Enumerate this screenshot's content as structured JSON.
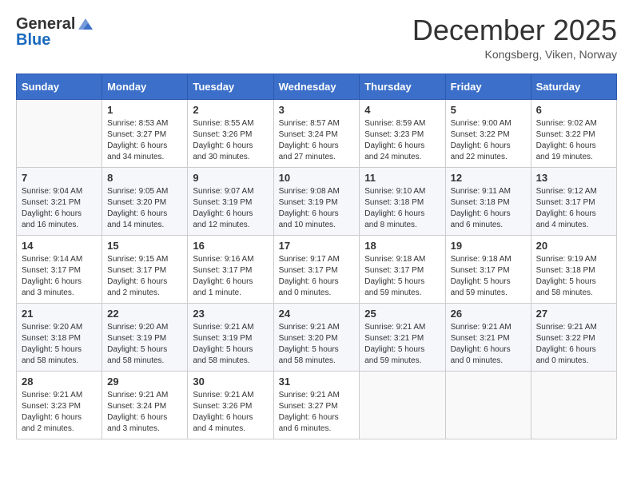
{
  "header": {
    "logo_general": "General",
    "logo_blue": "Blue",
    "month_title": "December 2025",
    "location": "Kongsberg, Viken, Norway"
  },
  "days_of_week": [
    "Sunday",
    "Monday",
    "Tuesday",
    "Wednesday",
    "Thursday",
    "Friday",
    "Saturday"
  ],
  "weeks": [
    [
      {
        "day": "",
        "info": ""
      },
      {
        "day": "1",
        "info": "Sunrise: 8:53 AM\nSunset: 3:27 PM\nDaylight: 6 hours\nand 34 minutes."
      },
      {
        "day": "2",
        "info": "Sunrise: 8:55 AM\nSunset: 3:26 PM\nDaylight: 6 hours\nand 30 minutes."
      },
      {
        "day": "3",
        "info": "Sunrise: 8:57 AM\nSunset: 3:24 PM\nDaylight: 6 hours\nand 27 minutes."
      },
      {
        "day": "4",
        "info": "Sunrise: 8:59 AM\nSunset: 3:23 PM\nDaylight: 6 hours\nand 24 minutes."
      },
      {
        "day": "5",
        "info": "Sunrise: 9:00 AM\nSunset: 3:22 PM\nDaylight: 6 hours\nand 22 minutes."
      },
      {
        "day": "6",
        "info": "Sunrise: 9:02 AM\nSunset: 3:22 PM\nDaylight: 6 hours\nand 19 minutes."
      }
    ],
    [
      {
        "day": "7",
        "info": "Sunrise: 9:04 AM\nSunset: 3:21 PM\nDaylight: 6 hours\nand 16 minutes."
      },
      {
        "day": "8",
        "info": "Sunrise: 9:05 AM\nSunset: 3:20 PM\nDaylight: 6 hours\nand 14 minutes."
      },
      {
        "day": "9",
        "info": "Sunrise: 9:07 AM\nSunset: 3:19 PM\nDaylight: 6 hours\nand 12 minutes."
      },
      {
        "day": "10",
        "info": "Sunrise: 9:08 AM\nSunset: 3:19 PM\nDaylight: 6 hours\nand 10 minutes."
      },
      {
        "day": "11",
        "info": "Sunrise: 9:10 AM\nSunset: 3:18 PM\nDaylight: 6 hours\nand 8 minutes."
      },
      {
        "day": "12",
        "info": "Sunrise: 9:11 AM\nSunset: 3:18 PM\nDaylight: 6 hours\nand 6 minutes."
      },
      {
        "day": "13",
        "info": "Sunrise: 9:12 AM\nSunset: 3:17 PM\nDaylight: 6 hours\nand 4 minutes."
      }
    ],
    [
      {
        "day": "14",
        "info": "Sunrise: 9:14 AM\nSunset: 3:17 PM\nDaylight: 6 hours\nand 3 minutes."
      },
      {
        "day": "15",
        "info": "Sunrise: 9:15 AM\nSunset: 3:17 PM\nDaylight: 6 hours\nand 2 minutes."
      },
      {
        "day": "16",
        "info": "Sunrise: 9:16 AM\nSunset: 3:17 PM\nDaylight: 6 hours\nand 1 minute."
      },
      {
        "day": "17",
        "info": "Sunrise: 9:17 AM\nSunset: 3:17 PM\nDaylight: 6 hours\nand 0 minutes."
      },
      {
        "day": "18",
        "info": "Sunrise: 9:18 AM\nSunset: 3:17 PM\nDaylight: 5 hours\nand 59 minutes."
      },
      {
        "day": "19",
        "info": "Sunrise: 9:18 AM\nSunset: 3:17 PM\nDaylight: 5 hours\nand 59 minutes."
      },
      {
        "day": "20",
        "info": "Sunrise: 9:19 AM\nSunset: 3:18 PM\nDaylight: 5 hours\nand 58 minutes."
      }
    ],
    [
      {
        "day": "21",
        "info": "Sunrise: 9:20 AM\nSunset: 3:18 PM\nDaylight: 5 hours\nand 58 minutes."
      },
      {
        "day": "22",
        "info": "Sunrise: 9:20 AM\nSunset: 3:19 PM\nDaylight: 5 hours\nand 58 minutes."
      },
      {
        "day": "23",
        "info": "Sunrise: 9:21 AM\nSunset: 3:19 PM\nDaylight: 5 hours\nand 58 minutes."
      },
      {
        "day": "24",
        "info": "Sunrise: 9:21 AM\nSunset: 3:20 PM\nDaylight: 5 hours\nand 58 minutes."
      },
      {
        "day": "25",
        "info": "Sunrise: 9:21 AM\nSunset: 3:21 PM\nDaylight: 5 hours\nand 59 minutes."
      },
      {
        "day": "26",
        "info": "Sunrise: 9:21 AM\nSunset: 3:21 PM\nDaylight: 6 hours\nand 0 minutes."
      },
      {
        "day": "27",
        "info": "Sunrise: 9:21 AM\nSunset: 3:22 PM\nDaylight: 6 hours\nand 0 minutes."
      }
    ],
    [
      {
        "day": "28",
        "info": "Sunrise: 9:21 AM\nSunset: 3:23 PM\nDaylight: 6 hours\nand 2 minutes."
      },
      {
        "day": "29",
        "info": "Sunrise: 9:21 AM\nSunset: 3:24 PM\nDaylight: 6 hours\nand 3 minutes."
      },
      {
        "day": "30",
        "info": "Sunrise: 9:21 AM\nSunset: 3:26 PM\nDaylight: 6 hours\nand 4 minutes."
      },
      {
        "day": "31",
        "info": "Sunrise: 9:21 AM\nSunset: 3:27 PM\nDaylight: 6 hours\nand 6 minutes."
      },
      {
        "day": "",
        "info": ""
      },
      {
        "day": "",
        "info": ""
      },
      {
        "day": "",
        "info": ""
      }
    ]
  ]
}
